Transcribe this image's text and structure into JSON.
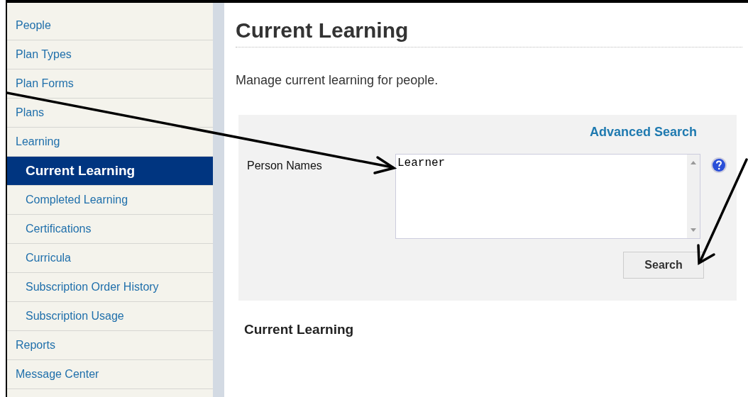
{
  "sidebar": {
    "items": [
      {
        "label": "People",
        "selected": false
      },
      {
        "label": "Plan Types",
        "selected": false
      },
      {
        "label": "Plan Forms",
        "selected": false
      },
      {
        "label": "Plans",
        "selected": false
      },
      {
        "label": "Learning",
        "selected": false,
        "children": [
          {
            "label": "Current Learning",
            "selected": true
          },
          {
            "label": "Completed Learning",
            "selected": false
          },
          {
            "label": "Certifications",
            "selected": false
          },
          {
            "label": "Curricula",
            "selected": false
          },
          {
            "label": "Subscription Order History",
            "selected": false
          },
          {
            "label": "Subscription Usage",
            "selected": false
          }
        ]
      },
      {
        "label": "Reports",
        "selected": false
      },
      {
        "label": "Message Center",
        "selected": false
      }
    ]
  },
  "page": {
    "title": "Current Learning",
    "description": "Manage current learning for people.",
    "search_panel": {
      "advanced_link": "Advanced Search",
      "field_label": "Person Names",
      "field_value": "Learner",
      "button": "Search"
    },
    "section_title": "Current Learning"
  }
}
